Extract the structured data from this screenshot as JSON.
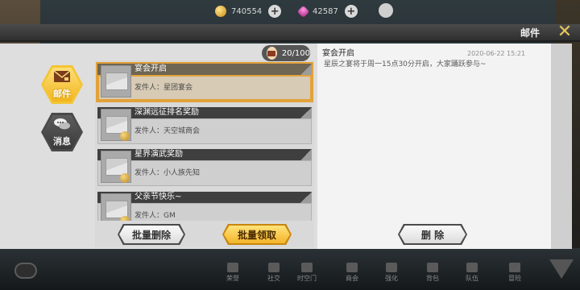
{
  "top_bar": {
    "gold_amount": "740554",
    "gem_amount": "42587",
    "plus_symbol": "+"
  },
  "window": {
    "title": "邮件",
    "close_symbol": "✕"
  },
  "tabs": [
    {
      "label": "邮件",
      "icon": "envelope-icon",
      "active": true
    },
    {
      "label": "消息",
      "icon": "chat-bubbles-icon",
      "active": false
    }
  ],
  "counter": "20/100",
  "mails": [
    {
      "title": "宴会开启",
      "sender": "发件人：星团宴会",
      "selected": true
    },
    {
      "title": "深渊远征排名奖励",
      "sender": "发件人：天空城商会",
      "selected": false
    },
    {
      "title": "星界演武奖励",
      "sender": "发件人：小人族先知",
      "selected": false
    },
    {
      "title": "父亲节快乐~",
      "sender": "发件人：GM",
      "selected": false
    }
  ],
  "detail": {
    "title": "宴会开启",
    "date": "2020-06-22  15:21",
    "body": "星辰之宴将于周一15点30分开启，大家踊跃参与~"
  },
  "buttons": {
    "batch_delete": "批量删除",
    "batch_collect": "批量领取",
    "delete": "删 除"
  },
  "bottom_nav": [
    "荣誉",
    "社交",
    "时空门",
    "商会",
    "强化",
    "背包",
    "队伍",
    "冒险"
  ],
  "colors": {
    "accent_gold": "#f3b52b",
    "selected_border": "#e2a23a",
    "list_header": "#3f3f3f"
  }
}
